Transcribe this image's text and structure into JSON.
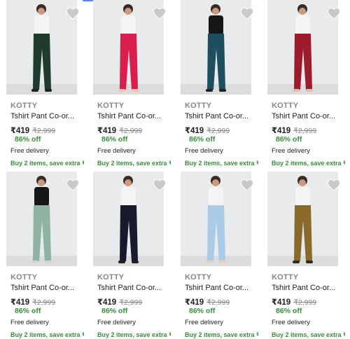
{
  "products": [
    {
      "brand": "KOTTY",
      "title": "Tshirt Pant Co-or...",
      "price": "₹419",
      "mrp": "₹2,999",
      "discount": "86% off",
      "delivery": "Free delivery",
      "offer": "Buy 2 items, save extra ₹!",
      "top_color": "#f4f4f4",
      "pant_color": "#1f3b2d",
      "shoe_color": "#222222"
    },
    {
      "brand": "KOTTY",
      "title": "Tshirt Pant Co-or...",
      "price": "₹419",
      "mrp": "₹2,999",
      "discount": "86% off",
      "delivery": "Free delivery",
      "offer": "Buy 2 items, save extra ₹!",
      "top_color": "#f4f4f4",
      "pant_color": "#d81e4d",
      "shoe_color": "#e6c9b5"
    },
    {
      "brand": "KOTTY",
      "title": "Tshirt Pant Co-or...",
      "price": "₹419",
      "mrp": "₹2,999",
      "discount": "86% off",
      "delivery": "Free delivery",
      "offer": "Buy 2 items, save extra ₹!",
      "top_color": "#161616",
      "pant_color": "#1d4f5e",
      "shoe_color": "#222222"
    },
    {
      "brand": "KOTTY",
      "title": "Tshirt Pant Co-or...",
      "price": "₹419",
      "mrp": "₹2,999",
      "discount": "86% off",
      "delivery": "Free delivery",
      "offer": "Buy 2 items, save extra ₹!",
      "top_color": "#f4f4f4",
      "pant_color": "#9c1c2b",
      "shoe_color": "#d8c1ad"
    },
    {
      "brand": "KOTTY",
      "title": "Tshirt Pant Co-or...",
      "price": "₹419",
      "mrp": "₹2,999",
      "discount": "86% off",
      "delivery": "Free delivery",
      "offer": "Buy 2 items, save extra ₹!",
      "top_color": "#161616",
      "pant_color": "#8fb2a3",
      "shoe_color": "#d6d6d6"
    },
    {
      "brand": "KOTTY",
      "title": "Tshirt Pant Co-or...",
      "price": "₹419",
      "mrp": "₹2,999",
      "discount": "86% off",
      "delivery": "Free delivery",
      "offer": "Buy 2 items, save extra ₹!",
      "top_color": "#f4f4f4",
      "pant_color": "#171a2c",
      "shoe_color": "#222222"
    },
    {
      "brand": "KOTTY",
      "title": "Tshirt Pant Co-or...",
      "price": "₹419",
      "mrp": "₹2,999",
      "discount": "86% off",
      "delivery": "Free delivery",
      "offer": "Buy 2 items, save extra ₹!",
      "top_color": "#f4f4f4",
      "pant_color": "#a9cbe8",
      "shoe_color": "#e6d2c0"
    },
    {
      "brand": "KOTTY",
      "title": "Tshirt Pant Co-or...",
      "price": "₹419",
      "mrp": "₹2,999",
      "discount": "86% off",
      "delivery": "Free delivery",
      "offer": "Buy 2 items, save extra ₹!",
      "top_color": "#f4f4f4",
      "pant_color": "#8a6a2a",
      "shoe_color": "#2a2a2a"
    }
  ],
  "icons": {
    "wishlist": "heart-icon"
  },
  "colors": {
    "discount": "#388e3c",
    "brand": "#878787",
    "wishlist": "#c9c9c9",
    "tab_indicator": "#5b8def"
  }
}
